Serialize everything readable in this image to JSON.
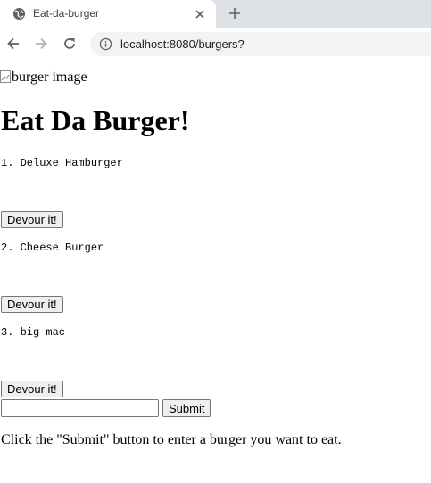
{
  "browser": {
    "tab_title": "Eat-da-burger",
    "url": "localhost:8080/burgers?"
  },
  "page": {
    "image_alt": "burger image",
    "title": "Eat Da Burger!",
    "burgers": [
      {
        "text": "1. Deluxe Hamburger",
        "button_label": "Devour it!"
      },
      {
        "text": "2. Cheese Burger",
        "button_label": "Devour it!"
      },
      {
        "text": "3. big mac",
        "button_label": "Devour it!"
      }
    ],
    "form": {
      "input_value": "",
      "submit_label": "Submit"
    },
    "instructions": "Click the \"Submit\" button to enter a burger you want to eat."
  }
}
